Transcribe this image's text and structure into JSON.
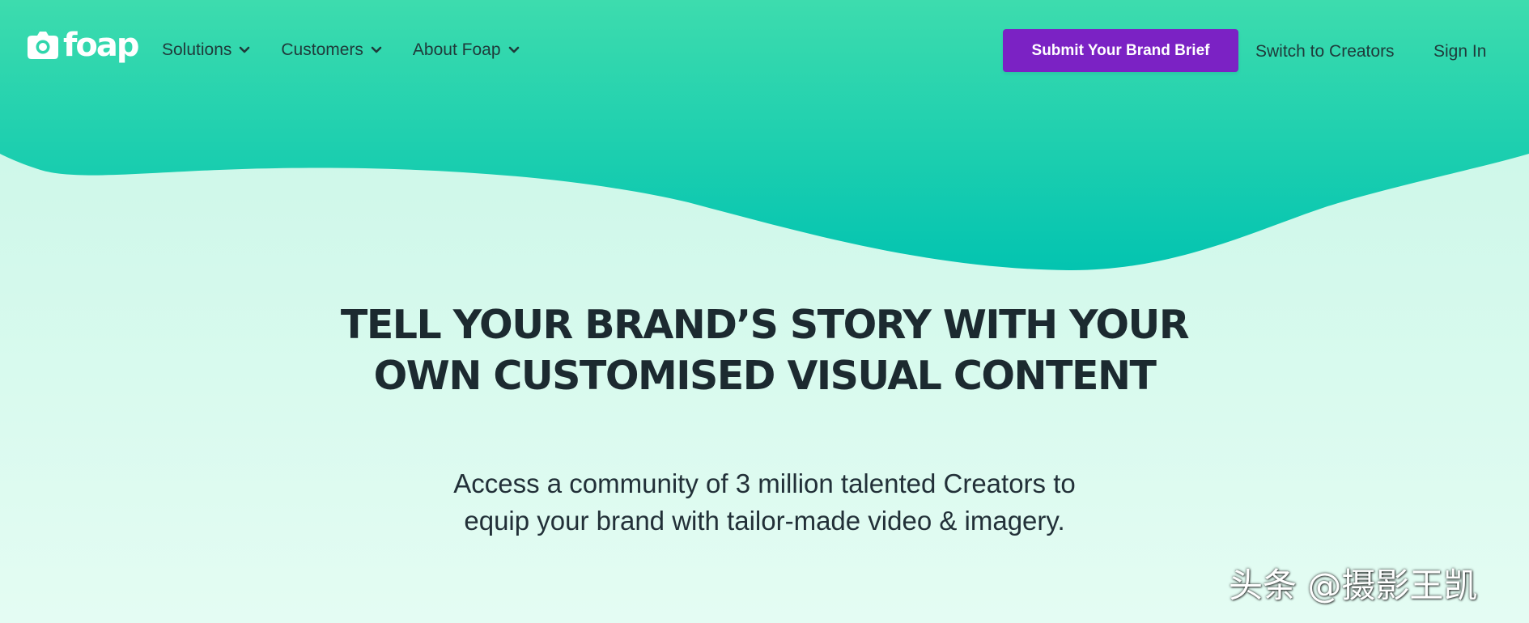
{
  "brand": {
    "name": "foap",
    "logo_icon": "camera-icon",
    "colors": {
      "header_top": "#3ddcae",
      "header_bottom": "#03c4b0",
      "page_background": "#d4f9ec",
      "cta": "#7b22c4",
      "text_dark": "#1c2a30"
    }
  },
  "nav": {
    "menus": [
      {
        "label": "Solutions",
        "icon": "chevron-down-icon"
      },
      {
        "label": "Customers",
        "icon": "chevron-down-icon"
      },
      {
        "label": "About Foap",
        "icon": "chevron-down-icon"
      }
    ],
    "cta_label": "Submit Your Brand Brief",
    "switch_label": "Switch to Creators",
    "signin_label": "Sign In"
  },
  "hero": {
    "title_line1": "TELL YOUR BRAND’S STORY WITH YOUR",
    "title_line2": "OWN CUSTOMISED VISUAL CONTENT",
    "subtitle_line1": "Access a community of 3 million talented Creators to",
    "subtitle_line2": "equip your brand with tailor-made video & imagery."
  },
  "watermark": {
    "text": "头条 @摄影王凯"
  }
}
